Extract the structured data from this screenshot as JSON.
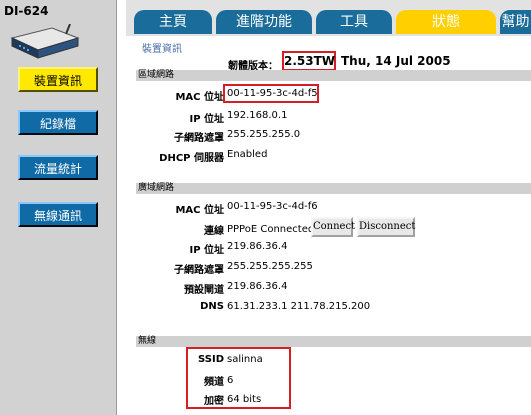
{
  "sidebar": {
    "model": "DI-624",
    "buttons": [
      {
        "label": "裝置資訊"
      },
      {
        "label": "紀錄檔"
      },
      {
        "label": "流量統計"
      },
      {
        "label": "無線通訊"
      }
    ]
  },
  "tabs": [
    {
      "label": "主頁"
    },
    {
      "label": "進階功能"
    },
    {
      "label": "工具"
    },
    {
      "label": "狀態"
    },
    {
      "label": "幫助"
    }
  ],
  "page": {
    "heading": "裝置資訊",
    "firmware_label": "韌體版本：",
    "firmware_version": "2.53TW",
    "firmware_date": "Thu, 14 Jul 2005"
  },
  "lan": {
    "title": "區域網路",
    "mac_label": "MAC 位址",
    "mac_value": "00-11-95-3c-4d-f5",
    "ip_label": "IP 位址",
    "ip_value": "192.168.0.1",
    "mask_label": "子網路遮罩",
    "mask_value": "255.255.255.0",
    "dhcp_label": "DHCP 伺服器",
    "dhcp_value": "Enabled"
  },
  "wan": {
    "title": "廣域網路",
    "mac_label": "MAC 位址",
    "mac_value": "00-11-95-3c-4d-f6",
    "conn_label": "連線",
    "conn_value": "PPPoE Connected",
    "connect_btn": "Connect",
    "disconnect_btn": "Disconnect",
    "ip_label": "IP 位址",
    "ip_value": "219.86.36.4",
    "mask_label": "子網路遮罩",
    "mask_value": "255.255.255.255",
    "gw_label": "預設閘道",
    "gw_value": "219.86.36.4",
    "dns_label": "DNS",
    "dns_value": "61.31.233.1 211.78.215.200"
  },
  "wireless": {
    "title": "無線",
    "ssid_label": "SSID",
    "ssid_value": "salinna",
    "channel_label": "頻道",
    "channel_value": "6",
    "enc_label": "加密",
    "enc_value": "64 bits"
  },
  "colors": {
    "tab_blue": "#1a6c9a",
    "tab_active": "#ffcf00",
    "side_active": "#ffe900",
    "side_inactive": "#106aa5",
    "highlight_red": "#d41f26"
  }
}
